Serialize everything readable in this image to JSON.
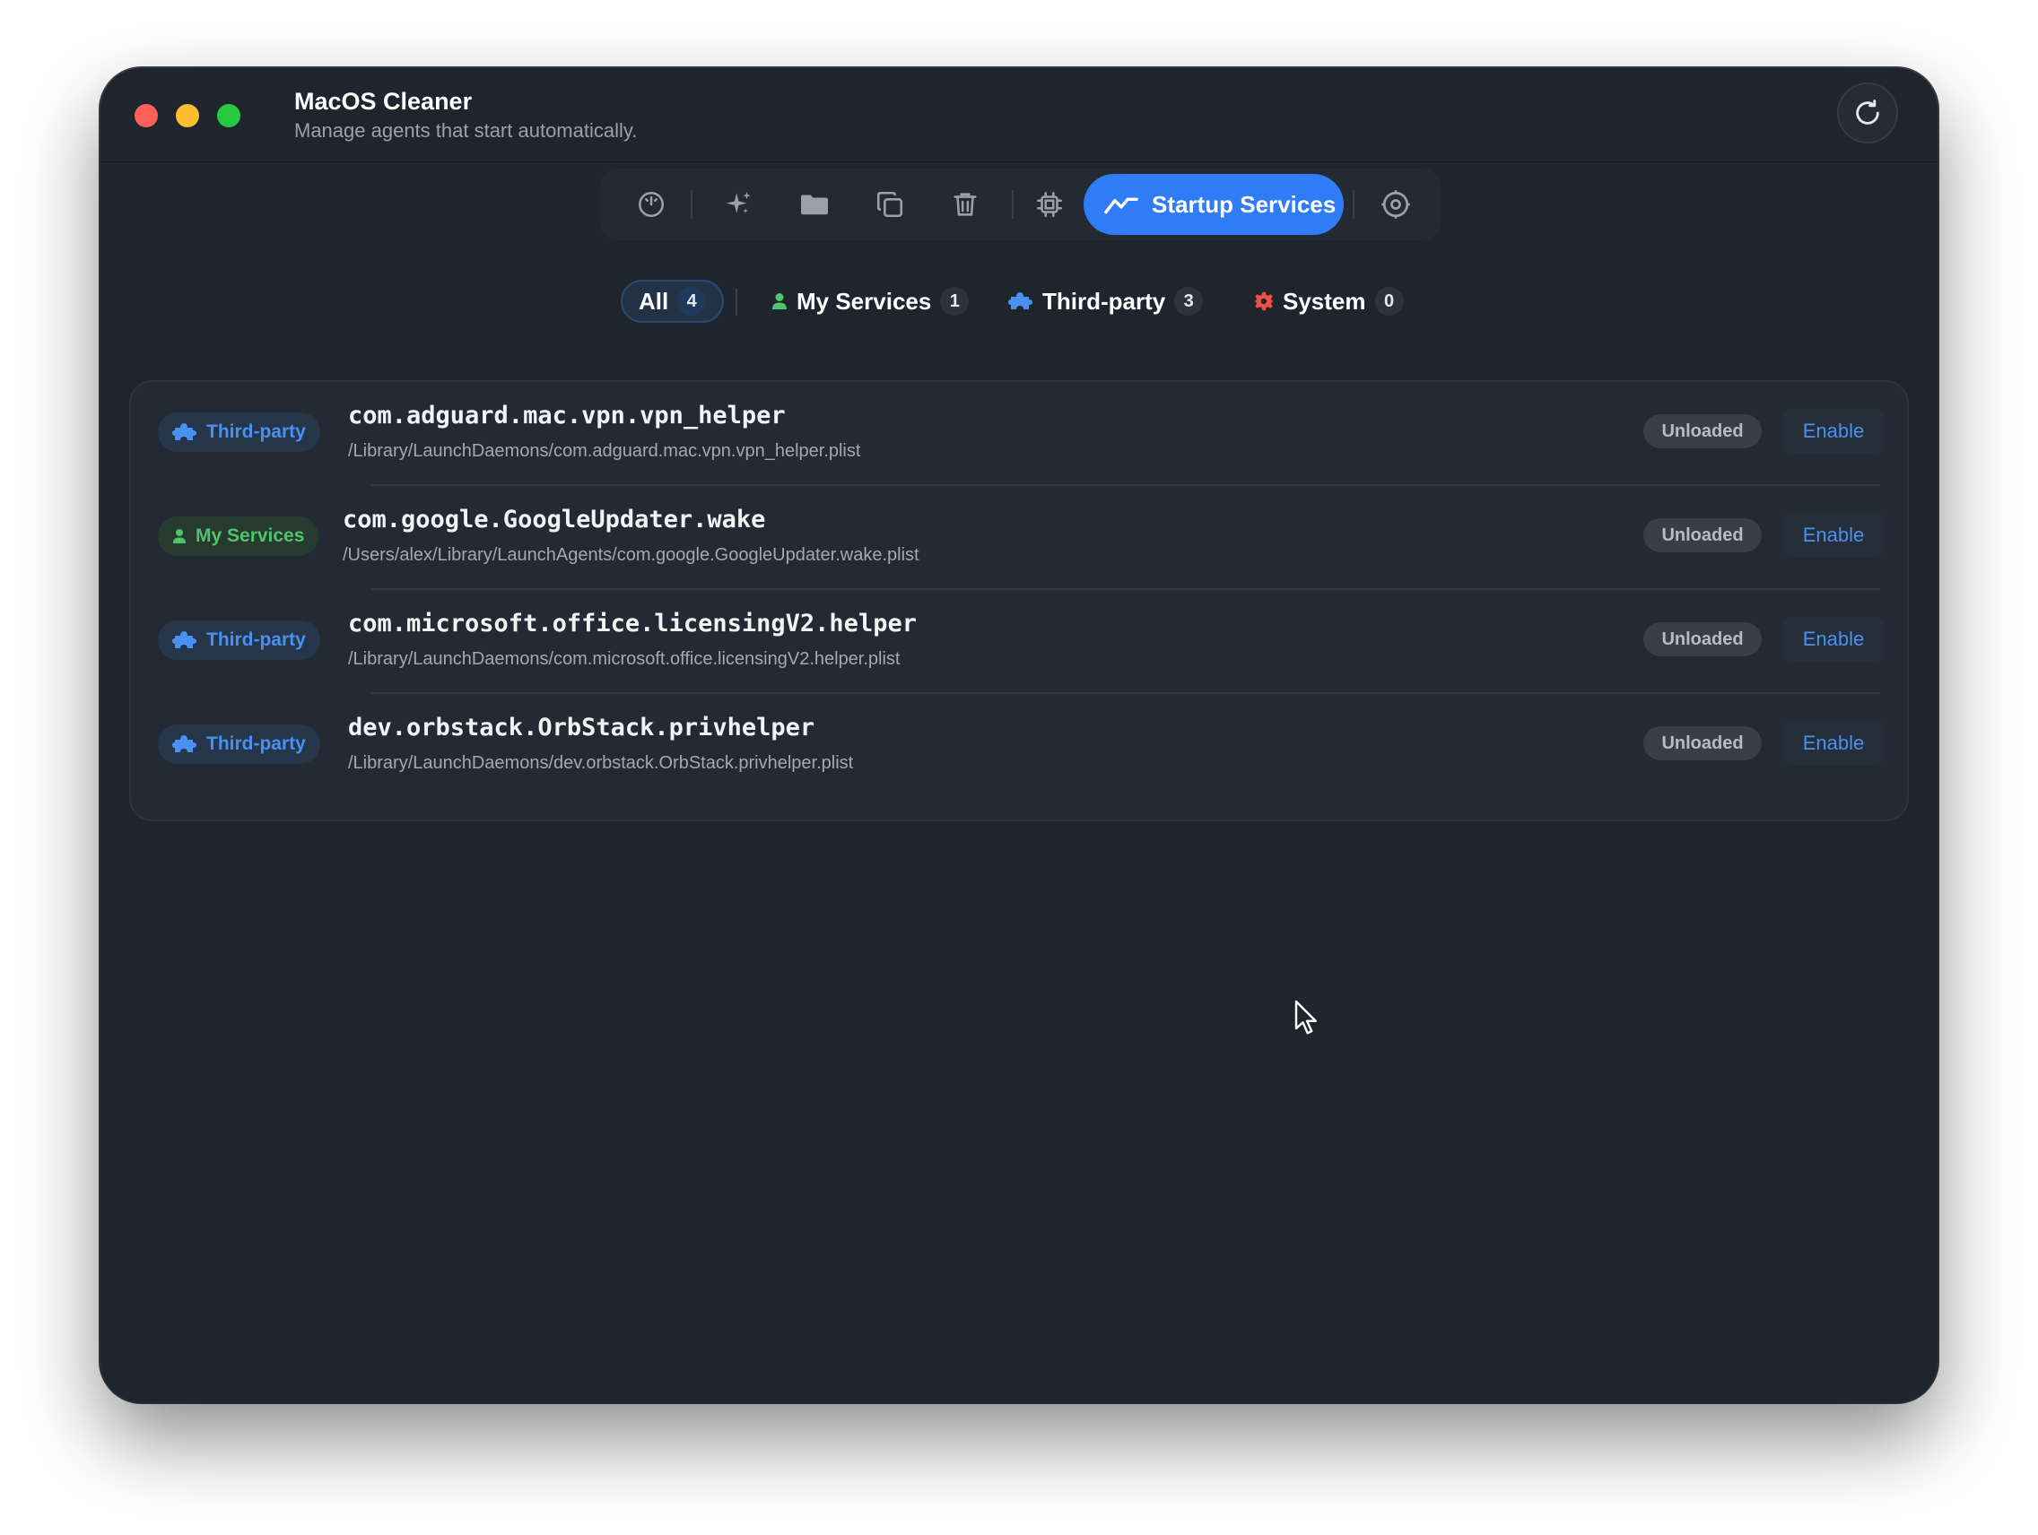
{
  "window": {
    "title": "MacOS Cleaner",
    "subtitle": "Manage agents that start automatically."
  },
  "toolbar": {
    "items": [
      {
        "icon": "gauge-icon"
      },
      {
        "icon": "sparkles-icon"
      },
      {
        "icon": "folder-icon"
      },
      {
        "icon": "duplicate-icon"
      },
      {
        "icon": "trash-icon"
      },
      {
        "icon": "cpu-icon"
      },
      {
        "icon": "waveform-icon",
        "label": "Startup Services",
        "active": true
      },
      {
        "icon": "gear-icon"
      }
    ],
    "active_label": "Startup Services"
  },
  "filters": [
    {
      "label": "All",
      "count": "4",
      "selected": true
    },
    {
      "label": "My Services",
      "count": "1",
      "icon": "person-icon",
      "color": "#4fc46a"
    },
    {
      "label": "Third-party",
      "count": "3",
      "icon": "puzzle-icon",
      "color": "#4a90f0"
    },
    {
      "label": "System",
      "count": "0",
      "icon": "gear-icon",
      "color": "#f0524a"
    }
  ],
  "services": [
    {
      "category": "Third-party",
      "name": "com.adguard.mac.vpn.vpn_helper",
      "path": "/Library/LaunchDaemons/com.adguard.mac.vpn.vpn_helper.plist",
      "status": "Unloaded",
      "action": "Enable"
    },
    {
      "category": "My Services",
      "name": "com.google.GoogleUpdater.wake",
      "path": "/Users/alex/Library/LaunchAgents/com.google.GoogleUpdater.wake.plist",
      "status": "Unloaded",
      "action": "Enable"
    },
    {
      "category": "Third-party",
      "name": "com.microsoft.office.licensingV2.helper",
      "path": "/Library/LaunchDaemons/com.microsoft.office.licensingV2.helper.plist",
      "status": "Unloaded",
      "action": "Enable"
    },
    {
      "category": "Third-party",
      "name": "dev.orbstack.OrbStack.privhelper",
      "path": "/Library/LaunchDaemons/dev.orbstack.OrbStack.privhelper.plist",
      "status": "Unloaded",
      "action": "Enable"
    }
  ],
  "colors": {
    "accent": "#2f7cf6",
    "third_party": "#4a90f0",
    "my_services": "#4fc46a",
    "system": "#f0524a",
    "window_bg": "#1f252d"
  }
}
